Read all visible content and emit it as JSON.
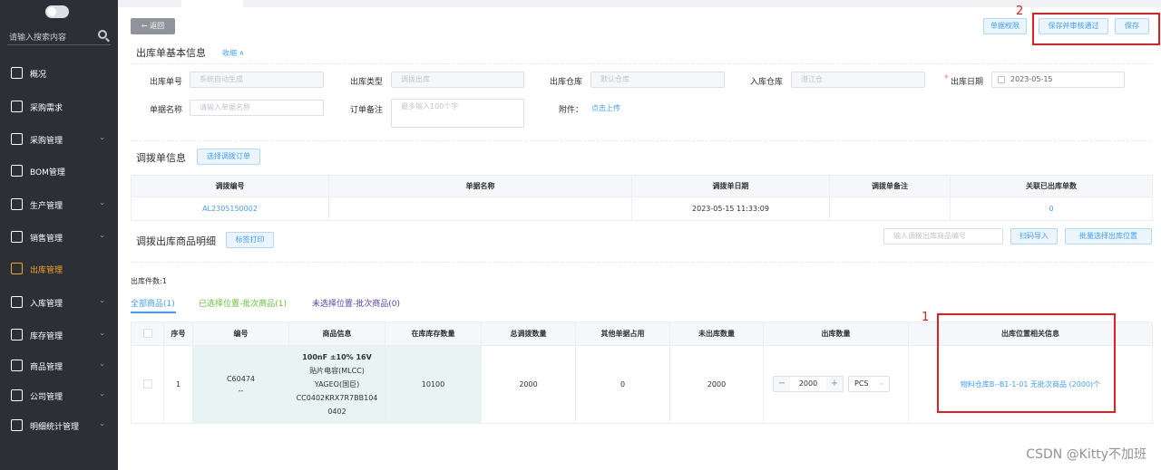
{
  "sidebar": {
    "search_placeholder": "请输入搜索内容",
    "items": [
      {
        "label": "概况",
        "icon": "menu-icon",
        "chevron": false
      },
      {
        "label": "采购需求",
        "icon": "cart-icon",
        "chevron": false
      },
      {
        "label": "采购管理",
        "icon": "truck-icon",
        "chevron": true
      },
      {
        "label": "BOM管理",
        "icon": "bom-icon",
        "chevron": false
      },
      {
        "label": "生产管理",
        "icon": "document-icon",
        "chevron": true
      },
      {
        "label": "销售管理",
        "icon": "sales-icon",
        "chevron": true
      },
      {
        "label": "出库管理",
        "icon": "outbound-icon",
        "chevron": false,
        "active": true
      },
      {
        "label": "入库管理",
        "icon": "inbound-icon",
        "chevron": true
      },
      {
        "label": "库存管理",
        "icon": "inventory-icon",
        "chevron": true
      },
      {
        "label": "商品管理",
        "icon": "goods-icon",
        "chevron": true
      },
      {
        "label": "公司管理",
        "icon": "company-icon",
        "chevron": true
      },
      {
        "label": "明细统计管理",
        "icon": "stats-icon",
        "chevron": true
      }
    ]
  },
  "toolbar": {
    "back_label": "← 返回",
    "permission_label": "单据权限",
    "save_approve_label": "保存并审核通过",
    "save_label": "保存"
  },
  "basic_info": {
    "title": "出库单基本信息",
    "collapse_label": "收缩 ∧",
    "order_no_label": "出库单号",
    "order_no_placeholder": "系统自动生成",
    "type_label": "出库类型",
    "type_value": "调拨出库",
    "warehouse_label": "出库仓库",
    "warehouse_value": "默认仓库",
    "in_warehouse_label": "入库仓库",
    "in_warehouse_value": "湛江仓",
    "date_required": "*",
    "date_label": "出库日期",
    "date_value": "2023-05-15",
    "name_label": "单据名称",
    "name_placeholder": "请输入单据名称",
    "remark_label": "订单备注",
    "remark_placeholder": "最多输入100个字",
    "attach_label": "附件：",
    "upload_label": "点击上传"
  },
  "transfer_info": {
    "title": "调拨单信息",
    "select_button": "选择调拨订单",
    "headers": [
      "调拨编号",
      "单据名称",
      "调拨单日期",
      "调拨单备注",
      "关联已出库单数"
    ],
    "rows": [
      {
        "code": "AL2305150002",
        "name": "",
        "date": "2023-05-15 11:33:09",
        "remark": "",
        "count": "0"
      }
    ]
  },
  "details": {
    "title": "调拨出库商品明细",
    "print_button": "标签打印",
    "search_placeholder": "输入调拨出库商品编号",
    "scan_button": "扫码导入",
    "batch_button": "批量选择出库位置",
    "count_text": "出库件数:1",
    "filters": [
      {
        "label": "全部商品(1)",
        "color": "#409eff"
      },
      {
        "label": "已选择位置-批次商品(1)",
        "color": "#67c23a"
      },
      {
        "label": "未选择位置-批次商品(0)",
        "color": "#5b3fb5"
      }
    ],
    "headers": [
      "序号",
      "编号",
      "商品信息",
      "在库库存数量",
      "总调拨数量",
      "其他单据占用",
      "未出库数量",
      "出库数量",
      "出库位置相关信息"
    ],
    "rows": [
      {
        "index": "1",
        "code_line1": "C60474",
        "code_line2": "--",
        "info_title": "100nF ±10% 16V",
        "info_line2": "贴片电容(MLCC)",
        "info_line3": "YAGEO(国巨)",
        "info_line4": "CC0402KRX7R7BB104",
        "info_line5": "0402",
        "stock": "10100",
        "total": "2000",
        "occupied": "0",
        "pending": "2000",
        "qty": "2000",
        "minus": "−",
        "plus": "+",
        "unit": "PCS",
        "location": "物料仓库B--B1-1-01 无批次商品 (2000)个"
      }
    ]
  },
  "annotations": {
    "box1": "1",
    "box2": "2"
  },
  "watermark": "CSDN @Kitty不加班"
}
